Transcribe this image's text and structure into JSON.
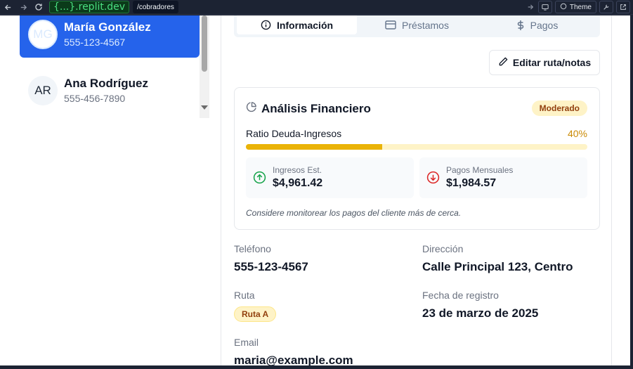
{
  "browser": {
    "domain": "{...}.replit.dev",
    "path": "/cobradores",
    "theme_label": "Theme"
  },
  "clients": [
    {
      "initials": "MG",
      "name": "María González",
      "phone": "555-123-4567",
      "active": true
    },
    {
      "initials": "AR",
      "name": "Ana Rodríguez",
      "phone": "555-456-7890",
      "active": false
    }
  ],
  "tabs": [
    {
      "label": "Información",
      "icon": "info-icon",
      "active": true
    },
    {
      "label": "Préstamos",
      "icon": "credit-card-icon",
      "active": false
    },
    {
      "label": "Pagos",
      "icon": "dollar-sign-icon",
      "active": false
    }
  ],
  "edit_button": {
    "label": "Editar ruta/notas",
    "icon": "pencil-icon"
  },
  "financial": {
    "title": "Análisis Financiero",
    "badge": "Moderado",
    "ratio_label": "Ratio Deuda-Ingresos",
    "ratio_value": "40%",
    "ratio_fraction": 0.4,
    "income_label": "Ingresos Est.",
    "income_value": "$4,961.42",
    "payments_label": "Pagos Mensuales",
    "payments_value": "$1,984.57",
    "note": "Considere monitorear los pagos del cliente más de cerca."
  },
  "details": {
    "phone_label": "Teléfono",
    "phone_value": "555-123-4567",
    "address_label": "Dirección",
    "address_value": "Calle Principal 123, Centro",
    "route_label": "Ruta",
    "route_value": "Ruta A",
    "date_label": "Fecha de registro",
    "date_value": "23 de marzo de 2025",
    "email_label": "Email",
    "email_value": "maria@example.com"
  },
  "colors": {
    "accent": "#2563eb",
    "warning": "#eab308",
    "success": "#16a34a",
    "danger": "#dc2626"
  }
}
